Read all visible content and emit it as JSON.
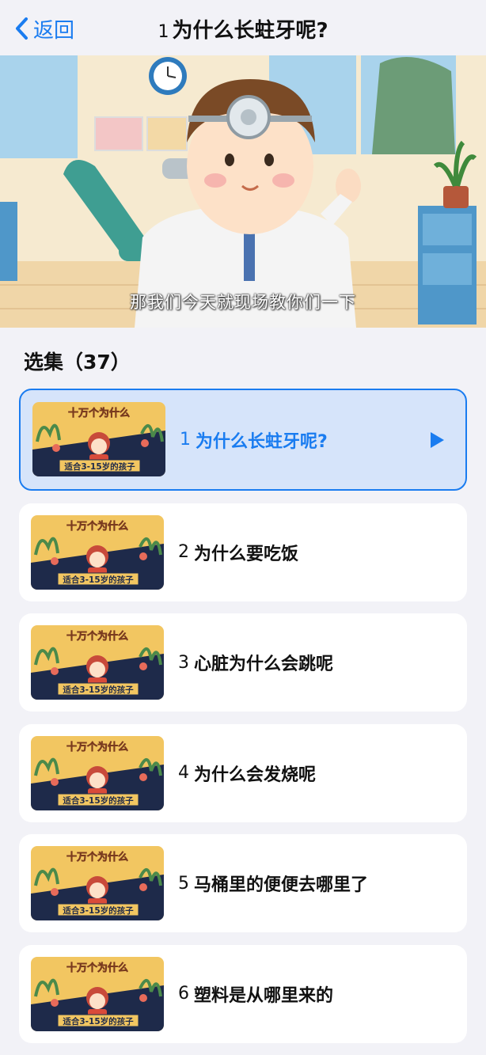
{
  "header": {
    "back_label": "返回",
    "title_number": "1",
    "title_text": "为什么长蛀牙呢?"
  },
  "player": {
    "subtitle": "那我们今天就现场教你们一下"
  },
  "episodes_section": {
    "title": "选集（37）"
  },
  "thumbnail": {
    "banner": "十万个为什么",
    "tagline": "适合3-15岁的孩子"
  },
  "episodes": [
    {
      "number": "1",
      "title": "为什么长蛀牙呢?",
      "active": true
    },
    {
      "number": "2",
      "title": "为什么要吃饭",
      "active": false
    },
    {
      "number": "3",
      "title": "心脏为什么会跳呢",
      "active": false
    },
    {
      "number": "4",
      "title": "为什么会发烧呢",
      "active": false
    },
    {
      "number": "5",
      "title": "马桶里的便便去哪里了",
      "active": false
    },
    {
      "number": "6",
      "title": "塑料是从哪里来的",
      "active": false
    }
  ],
  "colors": {
    "accent": "#1a7cf0",
    "active_bg": "#d6e4fa",
    "page_bg": "#f2f2f7"
  }
}
